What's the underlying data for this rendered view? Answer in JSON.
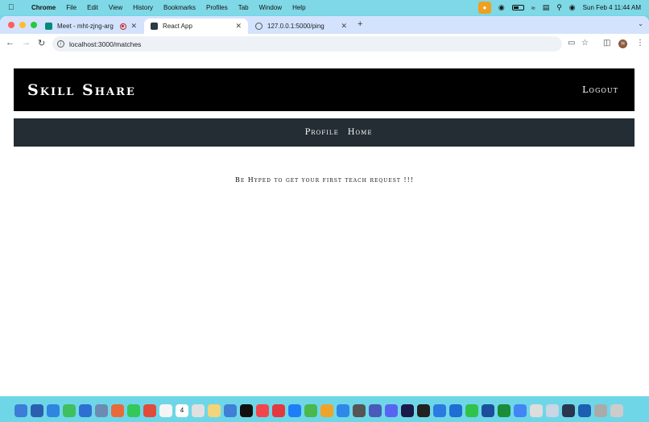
{
  "menubar": {
    "app": "Chrome",
    "items": [
      "File",
      "Edit",
      "View",
      "History",
      "Bookmarks",
      "Profiles",
      "Tab",
      "Window",
      "Help"
    ],
    "clock": "Sun Feb 4  11:44 AM"
  },
  "tabs": [
    {
      "title": "Meet - mht-zjng-arg",
      "active": false
    },
    {
      "title": "React App",
      "active": true
    },
    {
      "title": "127.0.0.1:5000/ping",
      "active": false
    }
  ],
  "address_bar": {
    "url": "localhost:3000/matches"
  },
  "app": {
    "brand": "Skill Share",
    "logout": "Logout",
    "nav": [
      "Profile",
      "Home"
    ],
    "message": "Be Hyped to get your first teach request !!!"
  },
  "profile_initial": "H",
  "dock": {
    "calendar_day": "4",
    "icon_colors": [
      "#3b7dd8",
      "#2a5fb0",
      "#2e86de",
      "#3fbf5f",
      "#2f6fd1",
      "#6b8bb3",
      "#e86a3a",
      "#35c759",
      "#e04b3a",
      "#f5f5f5",
      "#8a6b3b",
      "#e0e0e0",
      "#f2d47a",
      "#3f7fd6",
      "#111111",
      "#f2464e",
      "#e2383f",
      "#1f7ef5",
      "#49b84d",
      "#f0a32a",
      "#2d88e8",
      "#555555",
      "#4a5ab8",
      "#5865f2",
      "#1a1a4a",
      "#222222",
      "#2a7ae2",
      "#1e6fd1",
      "#30c24b",
      "#1b4f9c",
      "#1a8c3a",
      "#4285f4",
      "#dddddd",
      "#c9d6e3",
      "#2a3550",
      "#1d5fb0",
      "#aaaaaa",
      "#cccccc"
    ]
  }
}
